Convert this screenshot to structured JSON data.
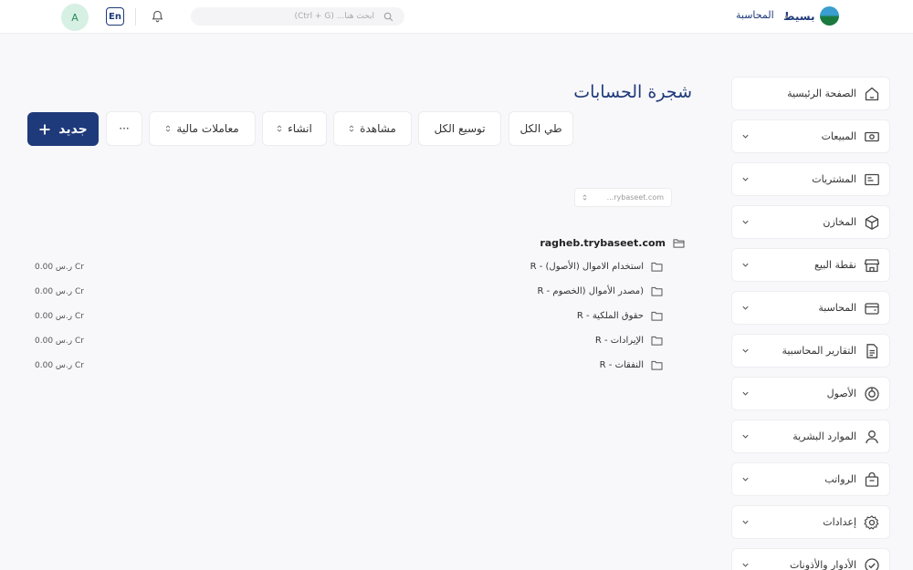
{
  "header": {
    "avatar_initial": "A",
    "language": "En",
    "search_placeholder": "ابحث هنا... (Ctrl + G)",
    "brand_name": "بسيط",
    "breadcrumb": "المحاسبة"
  },
  "sidebar": {
    "items": [
      {
        "label": "الصفحة الرئيسية",
        "icon": "home-icon",
        "chevron": false
      },
      {
        "label": "المبيعات",
        "icon": "cash-icon",
        "chevron": true
      },
      {
        "label": "المشتريات",
        "icon": "receipt-icon",
        "chevron": true
      },
      {
        "label": "المخازن",
        "icon": "box-icon",
        "chevron": true
      },
      {
        "label": "نقطة البيع",
        "icon": "store-icon",
        "chevron": true
      },
      {
        "label": "المحاسبة",
        "icon": "wallet-icon",
        "chevron": true
      },
      {
        "label": "التقارير المحاسبية",
        "icon": "report-icon",
        "chevron": true
      },
      {
        "label": "الأصول",
        "icon": "pie-icon",
        "chevron": true
      },
      {
        "label": "الموارد البشرية",
        "icon": "user-icon",
        "chevron": true
      },
      {
        "label": "الرواتب",
        "icon": "bag-icon",
        "chevron": true
      },
      {
        "label": "إعدادات",
        "icon": "gear-icon",
        "chevron": true
      },
      {
        "label": "الأدوار والأذونات",
        "icon": "badge-check-icon",
        "chevron": true
      }
    ]
  },
  "main": {
    "title": "شجرة الحسابات",
    "toolbar": {
      "collapse_all": "طي الكل",
      "expand_all": "توسيع الكل",
      "view": "مشاهدة",
      "create": "انشاء",
      "financial": "معاملات مالية",
      "more": "···",
      "new": "جديد"
    },
    "filter_value": "rybaseet.com...",
    "tree": {
      "root": "ragheb.trybaseet.com",
      "accounts": [
        {
          "name": "استخدام الاموال (الأصول) - R",
          "balance": "ر.س 0.00 Cr"
        },
        {
          "name": "(مصدر الأموال (الخصوم - R",
          "balance": "ر.س 0.00 Cr"
        },
        {
          "name": "حقوق الملكية - R",
          "balance": "ر.س 0.00 Cr"
        },
        {
          "name": "الإيرادات - R",
          "balance": "ر.س 0.00 Cr"
        },
        {
          "name": "النفقات - R",
          "balance": "ر.س 0.00 Cr"
        }
      ]
    }
  }
}
